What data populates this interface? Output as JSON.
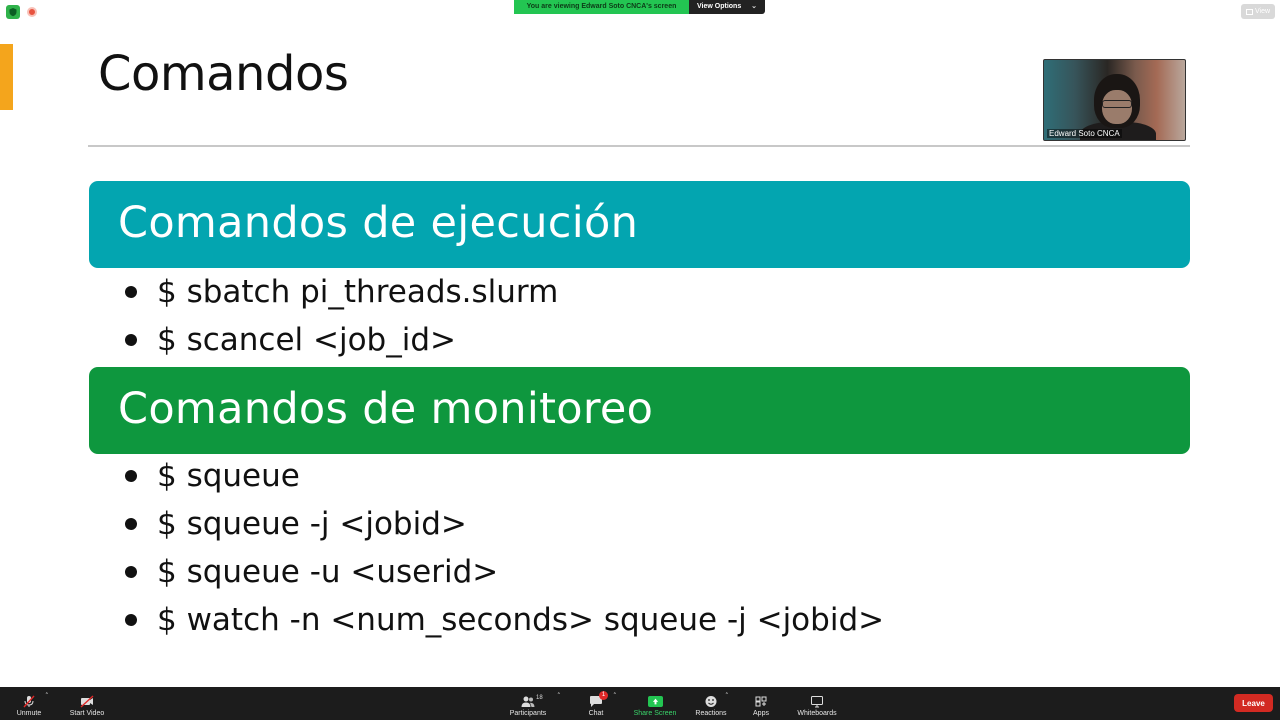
{
  "meeting": {
    "share_banner_text": "You are viewing Edward Soto CNCA's screen",
    "view_options_label": "View Options",
    "view_button_label": "View",
    "video_tile_name": "Edward Soto CNCA"
  },
  "slide": {
    "title": "Comandos",
    "sections": [
      {
        "heading": "Comandos de ejecución",
        "color": "#03a5b0",
        "items": [
          "$ sbatch pi_threads.slurm",
          "$ scancel <job_id>"
        ]
      },
      {
        "heading": "Comandos de monitoreo",
        "color": "#0e973e",
        "items": [
          "$ squeue",
          "$ squeue -j <jobid>",
          "$ squeue -u <userid>",
          "$ watch -n <num_seconds> squeue -j <jobid>"
        ]
      }
    ]
  },
  "toolbar": {
    "unmute": "Unmute",
    "start_video": "Start Video",
    "participants": "Participants",
    "participants_count": "18",
    "chat": "Chat",
    "chat_badge": "1",
    "share_screen": "Share Screen",
    "reactions": "Reactions",
    "apps": "Apps",
    "whiteboards": "Whiteboards",
    "leave": "Leave"
  },
  "colors": {
    "accent_orange": "#f4a51c",
    "share_green": "#23c552",
    "leave_red": "#d22a22",
    "toolbar_bg": "#1c1c1c"
  },
  "icons": [
    "shield-icon",
    "recording-icon",
    "grid-view-icon",
    "mic-muted-icon",
    "video-off-icon",
    "participants-icon",
    "chat-icon",
    "share-screen-icon",
    "reactions-icon",
    "apps-icon",
    "whiteboard-icon",
    "caret-up-icon"
  ]
}
